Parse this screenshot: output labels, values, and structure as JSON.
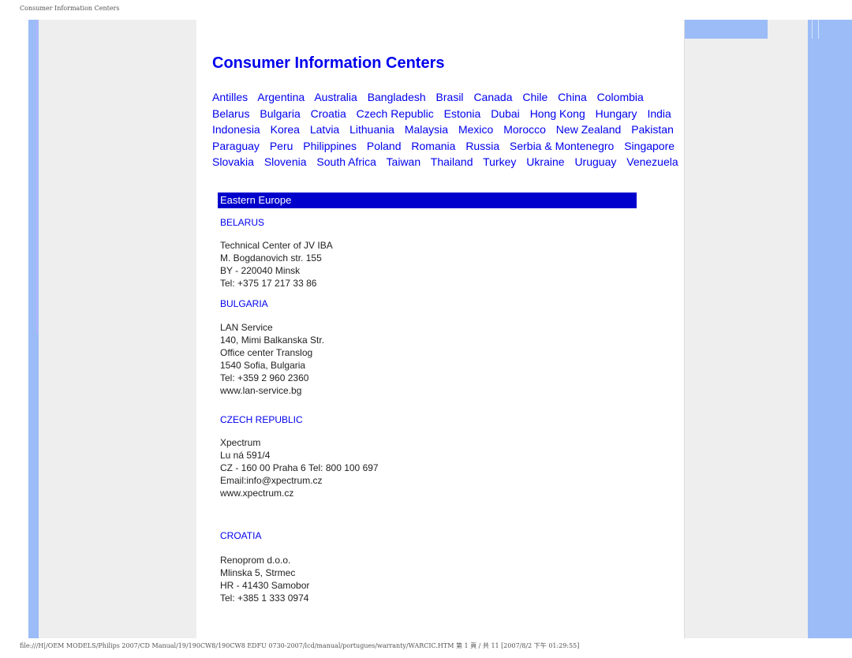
{
  "print_header": "Consumer Information Centers",
  "page_title": "Consumer Information Centers",
  "countries": [
    "Antilles",
    "Argentina",
    "Australia",
    "Bangladesh",
    "Brasil",
    "Canada",
    "Chile",
    "China",
    "Colombia",
    "Belarus",
    "Bulgaria",
    "Croatia",
    "Czech Republic",
    "Estonia",
    "Dubai",
    "Hong Kong",
    "Hungary",
    "India",
    "Indonesia",
    "Korea",
    "Latvia",
    "Lithuania",
    "Malaysia",
    "Mexico",
    "Morocco",
    "New Zealand",
    "Pakistan",
    "Paraguay",
    "Peru",
    "Philippines",
    "Poland",
    "Romania",
    "Russia",
    "Serbia & Montenegro",
    "Singapore",
    "Slovakia",
    "Slovenia",
    "South Africa",
    "Taiwan",
    "Thailand",
    "Turkey",
    "Ukraine",
    "Uruguay",
    "Venezuela"
  ],
  "region": "Eastern Europe",
  "entries": [
    {
      "country": "BELARUS",
      "lines": [
        "Technical Center of JV IBA",
        "M. Bogdanovich str. 155",
        "BY - 220040 Minsk",
        "Tel: +375 17 217 33 86"
      ]
    },
    {
      "country": "BULGARIA",
      "lines": [
        "LAN Service",
        "140, Mimi Balkanska Str.",
        "Office center Translog",
        "1540 Sofia, Bulgaria",
        "Tel: +359 2 960 2360",
        "www.lan-service.bg"
      ]
    },
    {
      "country": "CZECH REPUBLIC",
      "lines": [
        "Xpectrum",
        "Lu ná 591/4",
        "CZ - 160 00 Praha 6 Tel: 800 100 697",
        "Email:info@xpectrum.cz",
        "www.xpectrum.cz"
      ]
    },
    {
      "country": "CROATIA",
      "lines": [
        "Renoprom d.o.o.",
        "Mlinska 5, Strmec",
        "HR - 41430 Samobor",
        "Tel: +385 1 333 0974"
      ]
    }
  ],
  "print_footer": "file:///H|/OEM MODELS/Philips 2007/CD Manual/19/190CW8/190CW8 EDFU 0730-2007/lcd/manual/portugues/warranty/WARCIC.HTM 第 1 頁 / 共 11 [2007/8/2 下午 01:29:55]"
}
